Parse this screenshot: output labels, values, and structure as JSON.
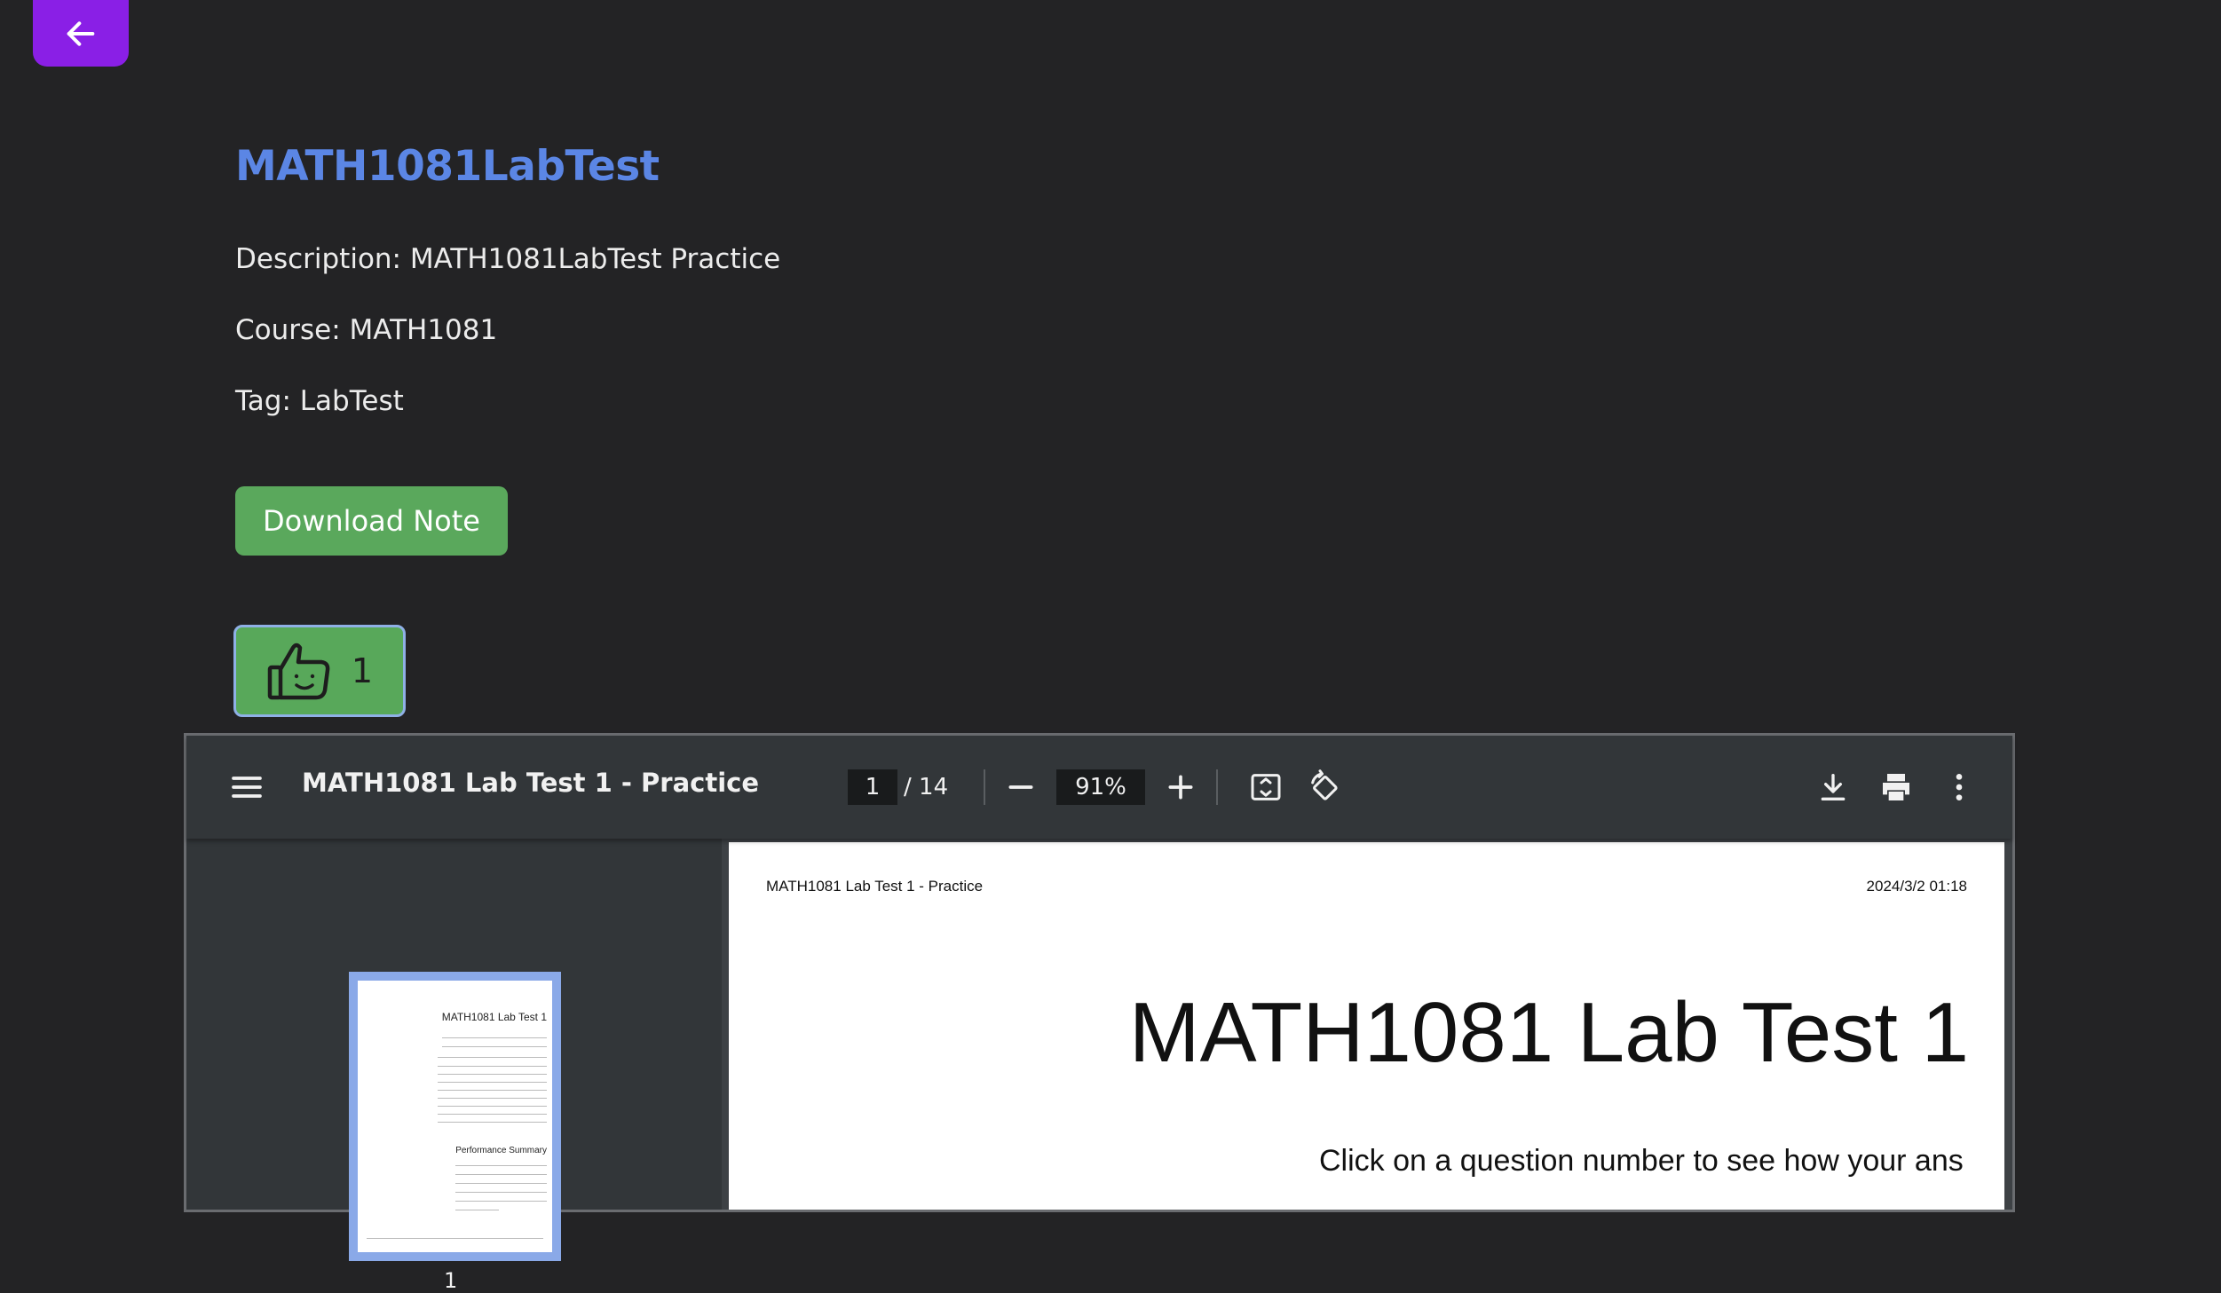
{
  "nav": {
    "back_icon": "arrow-left-icon",
    "back_color": "#8a1fe6"
  },
  "note": {
    "title": "MATH1081LabTest",
    "description": "Description: MATH1081LabTest Practice",
    "course": "Course: MATH1081",
    "tag": "Tag: LabTest",
    "download_label": "Download Note",
    "like_icon": "thumbs-up-icon",
    "like_count": "1"
  },
  "colors": {
    "title": "#5b86e5",
    "download_button": "#5aa85c",
    "like_button": "#58a85a"
  },
  "pdf_viewer": {
    "document_title": "MATH1081 Lab Test 1 - Practice",
    "current_page": "1",
    "total_pages": "/ 14",
    "zoom": "91%",
    "thumbnail_label": "1",
    "thumbnail_heading": "MATH1081 Lab Test 1",
    "thumbnail_subheading": "Performance Summary",
    "page": {
      "header_left": "MATH1081 Lab Test 1 - Practice",
      "header_right": "2024/3/2 01:18",
      "heading": "MATH1081 Lab Test 1",
      "line": "Click on a question number to see how your ans"
    }
  }
}
